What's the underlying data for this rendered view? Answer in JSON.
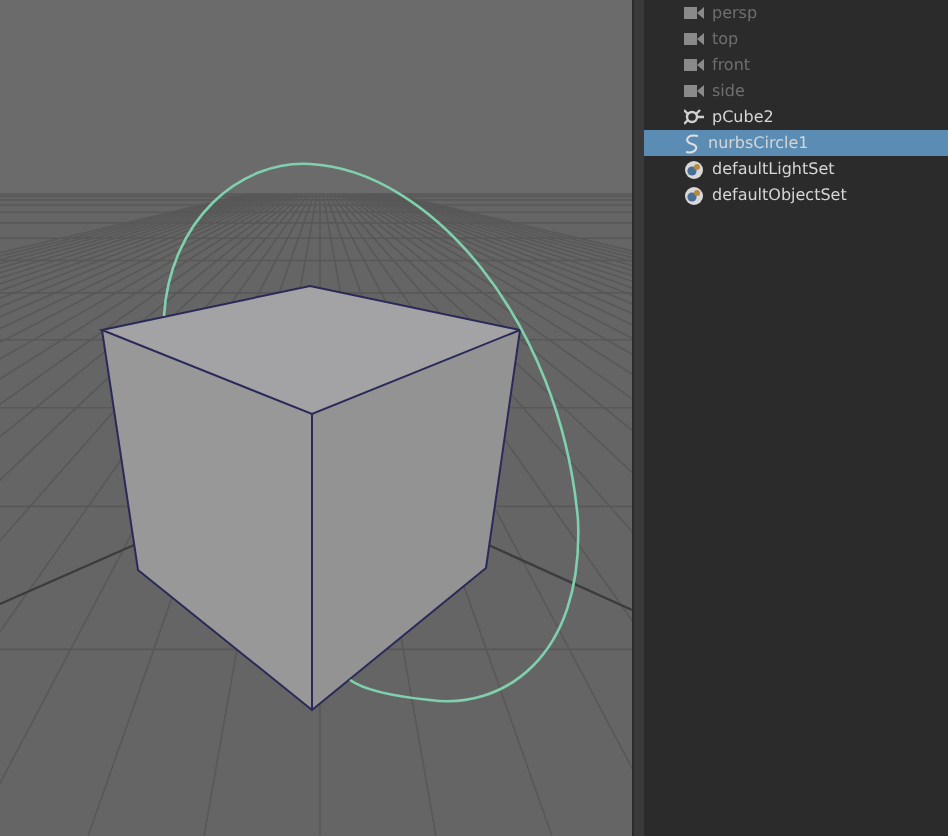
{
  "outliner": {
    "items": [
      {
        "label": "persp",
        "kind": "camera",
        "dimmed": true,
        "selected": false
      },
      {
        "label": "top",
        "kind": "camera",
        "dimmed": true,
        "selected": false
      },
      {
        "label": "front",
        "kind": "camera",
        "dimmed": true,
        "selected": false
      },
      {
        "label": "side",
        "kind": "camera",
        "dimmed": true,
        "selected": false
      },
      {
        "label": "pCube2",
        "kind": "transform",
        "dimmed": false,
        "selected": false
      },
      {
        "label": "nurbsCircle1",
        "kind": "curve",
        "dimmed": false,
        "selected": true
      },
      {
        "label": "defaultLightSet",
        "kind": "set",
        "dimmed": false,
        "selected": false
      },
      {
        "label": "defaultObjectSet",
        "kind": "set",
        "dimmed": false,
        "selected": false
      }
    ]
  }
}
